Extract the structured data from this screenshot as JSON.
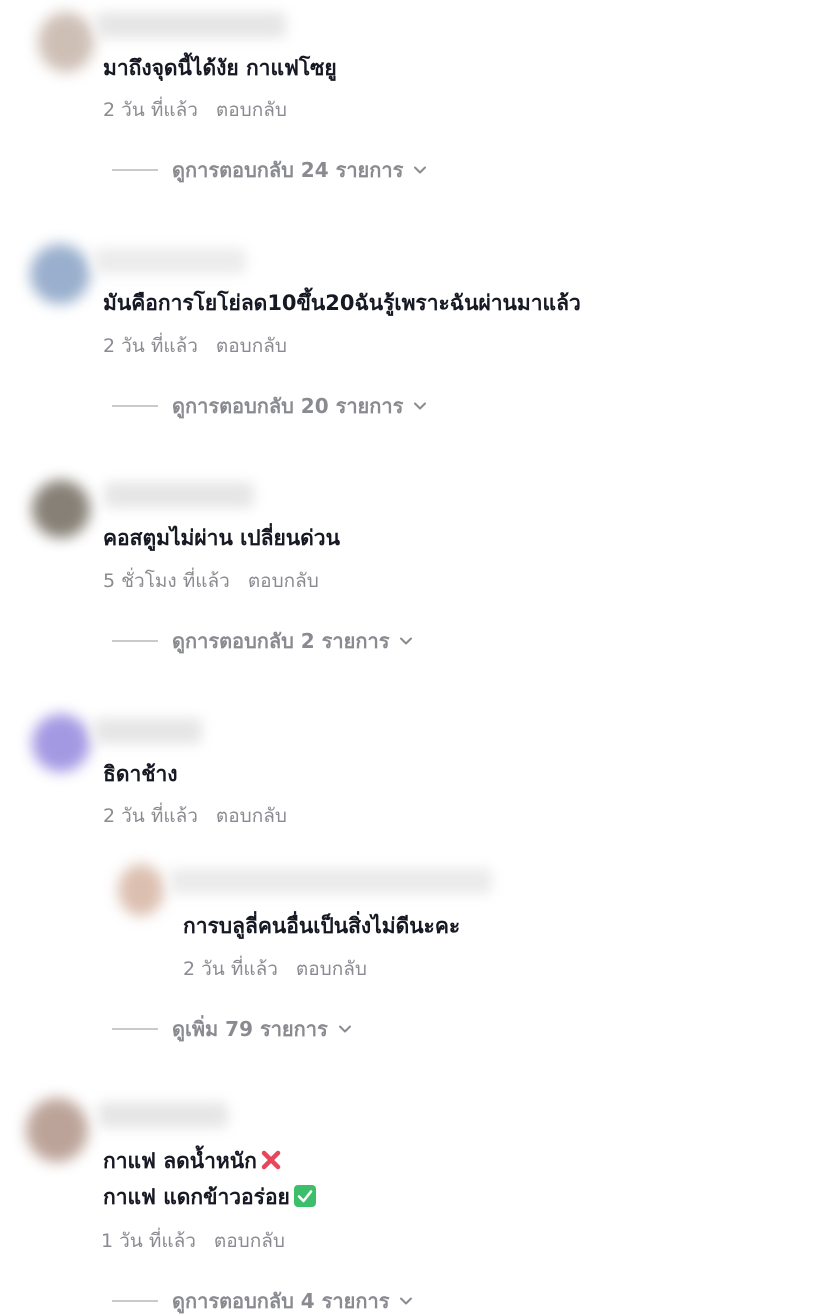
{
  "comments": [
    {
      "text": "มาถึงจุดนี้ได้งัย กาแฟโซยู",
      "time": "2 วัน ที่แล้ว",
      "reply": "ตอบกลับ",
      "view_replies": "ดูการตอบกลับ 24 รายการ"
    },
    {
      "text": "มันคือการโยโย่ลด10ขึ้น20ฉันรู้เพราะฉันผ่านมาแล้ว",
      "time": "2 วัน ที่แล้ว",
      "reply": "ตอบกลับ",
      "view_replies": "ดูการตอบกลับ 20 รายการ"
    },
    {
      "text": "คอสตูมไม่ผ่าน เปลี่ยนด่วน",
      "time": "5 ชั่วโมง ที่แล้ว",
      "reply": "ตอบกลับ",
      "view_replies": "ดูการตอบกลับ 2 รายการ"
    },
    {
      "text": "ธิดาช้าง",
      "time": "2 วัน ที่แล้ว",
      "reply": "ตอบกลับ",
      "nested_reply": {
        "text": "การบลูลี่คนอื่นเป็นสิ่งไม่ดีนะคะ",
        "time": "2 วัน ที่แล้ว",
        "reply": "ตอบกลับ"
      },
      "view_more": "ดูเพิ่ม 79 รายการ"
    },
    {
      "line1": "กาแฟ ลดน้ำหนัก",
      "line2": "กาแฟ แดกข้าวอร่อย",
      "time": "1 วัน ที่แล้ว",
      "reply": "ตอบกลับ",
      "view_replies": "ดูการตอบกลับ 4 รายการ"
    }
  ],
  "icons": {
    "chevron": "chevron-down-icon",
    "cross_emoji": "cross-mark-emoji-icon",
    "check_emoji": "check-mark-emoji-icon"
  },
  "colors": {
    "text": "#161823",
    "meta": "#8a8b91",
    "cross": "#e8465b",
    "check": "#3cbe6a"
  }
}
